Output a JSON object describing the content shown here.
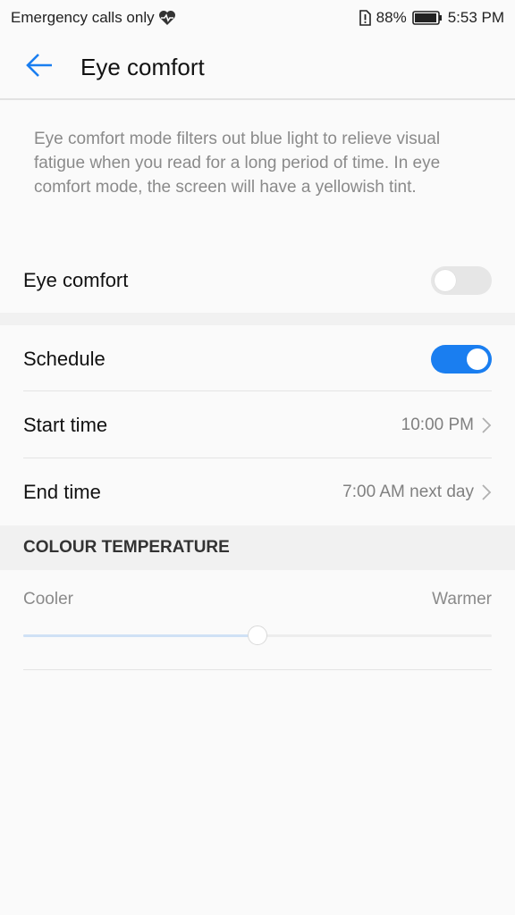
{
  "status_bar": {
    "carrier": "Emergency calls only",
    "battery_percent": "88%",
    "time": "5:53 PM",
    "icons": [
      "heart-icon",
      "sim-alert-icon",
      "battery-icon"
    ]
  },
  "app_bar": {
    "title": "Eye comfort",
    "back_icon": "arrow-left-icon"
  },
  "description": "Eye comfort mode filters out blue light to relieve visual fatigue when you read for a long period of time. In eye comfort mode, the screen will have a yellowish tint.",
  "eye_comfort": {
    "label": "Eye comfort",
    "enabled": false
  },
  "schedule": {
    "label": "Schedule",
    "enabled": true
  },
  "start_time": {
    "label": "Start time",
    "value": "10:00 PM"
  },
  "end_time": {
    "label": "End time",
    "value": "7:00 AM next day"
  },
  "colour_temperature": {
    "header": "COLOUR TEMPERATURE",
    "min_label": "Cooler",
    "max_label": "Warmer",
    "value_fraction": 0.5
  },
  "colors": {
    "accent": "#1a7ef0",
    "background": "#fafafa",
    "section_bg": "#f1f1f1"
  }
}
